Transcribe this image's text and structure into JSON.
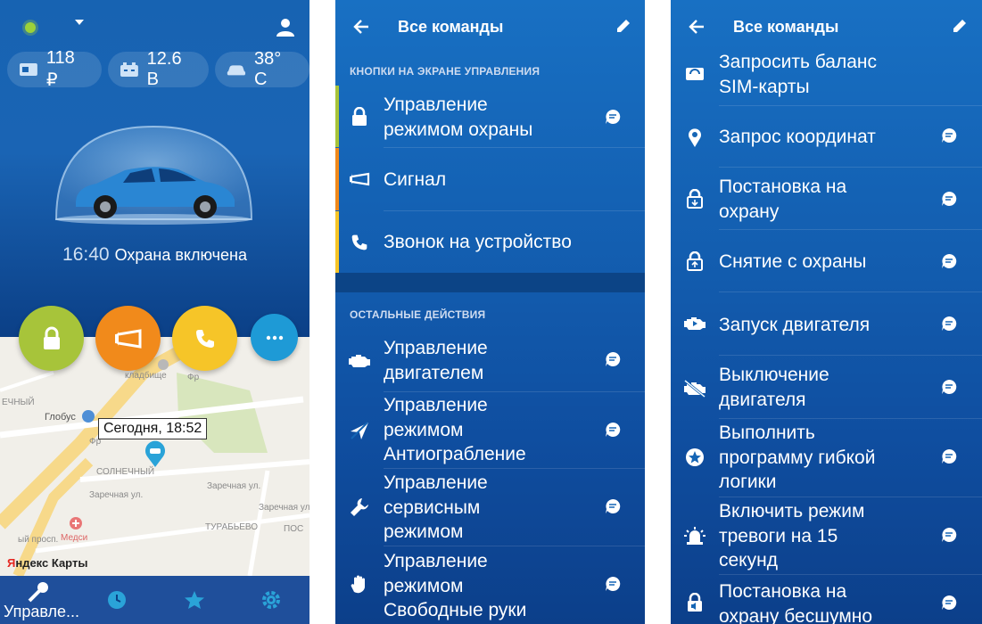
{
  "panel1": {
    "chips": [
      {
        "icon": "sim-balance-icon",
        "value": "118 ₽"
      },
      {
        "icon": "battery-icon",
        "value": "12.6 В"
      },
      {
        "icon": "car-temp-icon",
        "value": "38° С"
      }
    ],
    "status_time": "16:40",
    "status_text": "Охрана включена",
    "actions": [
      {
        "icon": "lock-icon",
        "color": "#a7c43a"
      },
      {
        "icon": "horn-icon",
        "color": "#f18a1b"
      },
      {
        "icon": "phone-icon",
        "color": "#f6c528"
      },
      {
        "icon": "more-icon",
        "color": "#1e9ad6"
      }
    ],
    "callout": "Сегодня, 18:52",
    "map_labels": {
      "cemetery_a": "Гр",
      "cemetery_b": "кладбище",
      "globus": "Глобус",
      "left_street": "ЕЧНЫЙ",
      "street_fr": "Фр",
      "street_fr2": "Фр",
      "solnechny": "СОЛНЕЧНЫЙ",
      "zarechnaya1": "Заречная ул.",
      "zarechnaya2": "Заречная ул.",
      "zarechnaya3": "Заречная ул.",
      "turabevo": "ТУРАБЬЕВО",
      "medsi": "Медси",
      "prosp": "ый просп.",
      "pos": "ПОС"
    },
    "yandex_a": "Я",
    "yandex_b": "ндекс Карты",
    "nav_label": "Управле..."
  },
  "panel2": {
    "title": "Все команды",
    "section1": "КНОПКИ НА ЭКРАНЕ УПРАВЛЕНИЯ",
    "section2": "ОСТАЛЬНЫЕ ДЕЙСТВИЯ",
    "rows_top": [
      {
        "label": "Управление\nрежимом охраны",
        "icon": "lock-icon",
        "stripe": "#a7c43a"
      },
      {
        "label": "Сигнал",
        "icon": "horn-icon",
        "stripe": "#f18a1b"
      },
      {
        "label": "Звонок на устройство",
        "icon": "phone-icon",
        "stripe": "#f6c528"
      }
    ],
    "rows_other": [
      {
        "label": "Управление\nдвигателем",
        "icon": "engine-icon"
      },
      {
        "label": "Управление\nрежимом\nАнтиограбление",
        "icon": "plane-icon"
      },
      {
        "label": "Управление\nсервисным\nрежимом",
        "icon": "wrench-icon"
      },
      {
        "label": "Управление\nрежимом\nСвободные руки",
        "icon": "hand-icon"
      }
    ]
  },
  "panel3": {
    "title": "Все команды",
    "rows": [
      {
        "label": "Запросить баланс\nSIM-карты",
        "icon": "sim-balance-icon"
      },
      {
        "label": "Запрос координат",
        "icon": "location-pin-icon"
      },
      {
        "label": "Постановка на\nохрану",
        "icon": "lock-arm-icon"
      },
      {
        "label": "Снятие с охраны",
        "icon": "lock-disarm-icon"
      },
      {
        "label": "Запуск двигателя",
        "icon": "engine-start-icon"
      },
      {
        "label": "Выключение\nдвигателя",
        "icon": "engine-off-icon"
      },
      {
        "label": "Выполнить\nпрограмму гибкой\nлогики",
        "icon": "star-circle-icon"
      },
      {
        "label": "Включить режим\nтревоги на 15\nсекунд",
        "icon": "alarm-icon"
      },
      {
        "label": "Постановка на\nохрану бесшумно",
        "icon": "silent-lock-icon"
      }
    ]
  },
  "colors": {
    "primary": "#1763b2",
    "nav": "#1f4f9b",
    "accent_green": "#a7c43a",
    "accent_orange": "#f18a1b",
    "accent_yellow": "#f6c528",
    "accent_blue": "#1e9ad6"
  }
}
